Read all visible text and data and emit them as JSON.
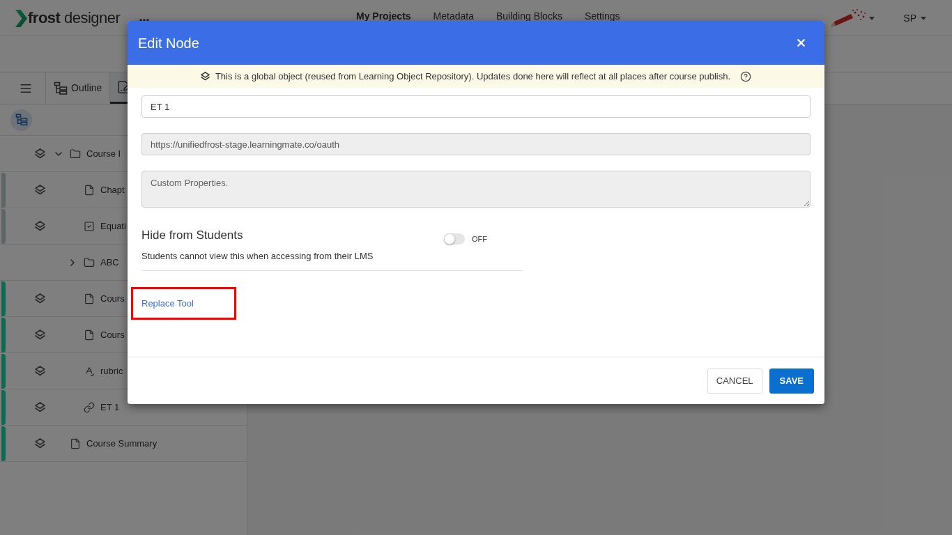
{
  "header": {
    "logo": "**frost** designer",
    "nav": [
      {
        "label": "My Projects",
        "selected": true
      },
      {
        "label": "Metadata",
        "selected": false
      },
      {
        "label": "Building Blocks",
        "selected": false
      },
      {
        "label": "Settings",
        "selected": false
      }
    ],
    "user": "SP"
  },
  "toolbar": {
    "tabs": [
      {
        "label": "Outline",
        "selected": false
      },
      {
        "selected": true
      }
    ]
  },
  "outline": [
    {
      "label": "Course I",
      "kind": "folder",
      "global": true,
      "expanded": true,
      "children": [
        {
          "label": "Chapt",
          "kind": "page",
          "global": true,
          "color": "#5f6565"
        },
        {
          "label": "Equati",
          "kind": "quiz",
          "global": true,
          "color": "#5f6565"
        },
        {
          "label": "ABC",
          "kind": "folder",
          "global": false,
          "expanded": false
        },
        {
          "label": "Cours",
          "kind": "page",
          "global": true,
          "color": "#0c6b50"
        },
        {
          "label": "Cours",
          "kind": "page",
          "global": true,
          "color": "#0c6b50"
        },
        {
          "label": "rubric",
          "kind": "rubric",
          "global": true,
          "color": "#0c6b50"
        },
        {
          "label": "ET 1",
          "kind": "link",
          "global": true,
          "color": "#0c6b50"
        }
      ]
    },
    {
      "label": "Course Summary",
      "kind": "page",
      "global": true,
      "color": "#0c6b50"
    }
  ],
  "dialog": {
    "title": "Edit Node",
    "notice": "This is a global object (reused from Learning Object Repository). Updates done here will reflect at all places after course publish.",
    "fields": [
      {
        "kind": "text",
        "value": "ET 1",
        "disabled": false
      },
      {
        "kind": "text",
        "value": "https://unifiedfrost-stage.learningmate.co/oauth",
        "disabled": true
      },
      {
        "kind": "textarea",
        "placeholder": "Custom Properties.",
        "disabled": true
      }
    ],
    "hide_from_students": {
      "title": "Hide from Students",
      "description": "Students cannot view this when accessing from their LMS",
      "on": false,
      "state_label": "OFF"
    },
    "replace_link": {
      "label": "Replace Tool",
      "highlighted": true
    },
    "buttons": [
      {
        "label": "CANCEL",
        "kind": "secondary"
      },
      {
        "label": "SAVE",
        "kind": "primary"
      }
    ]
  }
}
